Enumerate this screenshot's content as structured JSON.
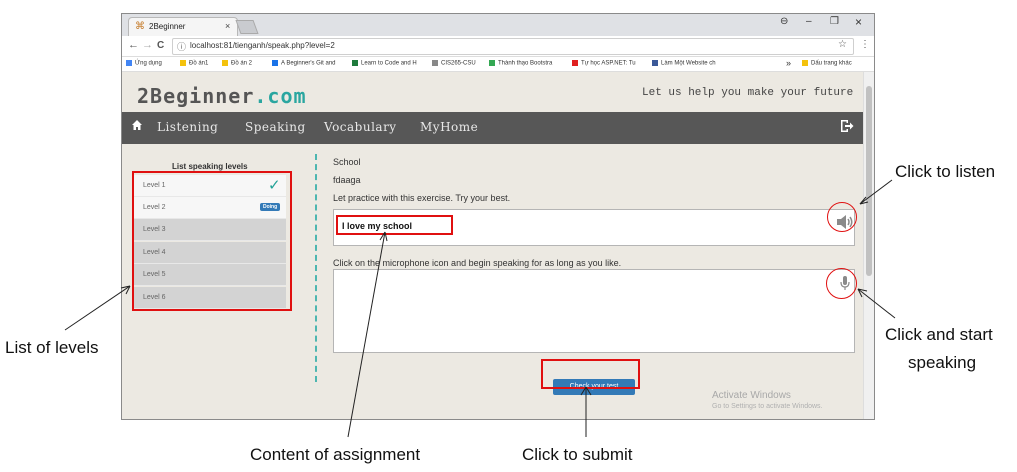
{
  "browser": {
    "tab_title": "2Beginner",
    "tab_close": "×",
    "window_controls": {
      "profile": "⊖",
      "minimize": "–",
      "restore": "❐",
      "close": "×"
    },
    "nav": {
      "back": "←",
      "forward": "→",
      "reload": "C"
    },
    "url": "localhost:81/tienganh/speak.php?level=2",
    "bookmarks": [
      {
        "label": "Ứng dụng",
        "color": "#4285f4"
      },
      {
        "label": "Đồ án1",
        "color": "#f4c20d"
      },
      {
        "label": "Đồ án 2",
        "color": "#f4c20d"
      },
      {
        "label": "A Beginner's Git and",
        "color": "#1a73e8"
      },
      {
        "label": "Learn to Code and H",
        "color": "#1e7a3c"
      },
      {
        "label": "CIS265-CSU",
        "color": "#888888"
      },
      {
        "label": "Thành thạo Bootstra",
        "color": "#34a853"
      },
      {
        "label": "Tự học ASP.NET: Tu",
        "color": "#e02020"
      },
      {
        "label": "Làm Một Website ch",
        "color": "#3b5998"
      }
    ],
    "bookmarks_more": "»",
    "bookmarks_other": "Dấu trang khác"
  },
  "site": {
    "logo_name": "2Beginner",
    "logo_domain": ".com",
    "slogan": "Let us help you make your future",
    "nav": [
      "Listening",
      "Speaking",
      "Vocabulary",
      "MyHome"
    ],
    "icons": {
      "home": "home-icon",
      "logout": "logout-icon"
    }
  },
  "levels": {
    "title": "List speaking levels",
    "items": [
      {
        "label": "Level 1",
        "status": "done"
      },
      {
        "label": "Level 2",
        "status": "Doing"
      },
      {
        "label": "Level 3",
        "status": ""
      },
      {
        "label": "Level 4",
        "status": ""
      },
      {
        "label": "Level 5",
        "status": ""
      },
      {
        "label": "Level 6",
        "status": ""
      }
    ],
    "check_mark": "✓"
  },
  "exercise": {
    "topic": "School",
    "subtitle": "fdaaga",
    "instruction": "Let practice with this exercise. Try your best.",
    "sentence": "I love my school",
    "mic_instruction": "Click on the microphone icon and begin speaking for as long as you like.",
    "submit_label": "Check your test"
  },
  "watermark": {
    "line1": "Activate Windows",
    "line2": "Go to Settings to activate Windows."
  },
  "annotations": {
    "listen": "Click to listen",
    "speak_line1": "Click and start",
    "speak_line2": "speaking",
    "levels": "List of levels",
    "content": "Content  of assignment",
    "submit": "Click to submit"
  },
  "colors": {
    "accent": "#2aa6a0",
    "button": "#337ab7",
    "annotation": "#e01010"
  }
}
